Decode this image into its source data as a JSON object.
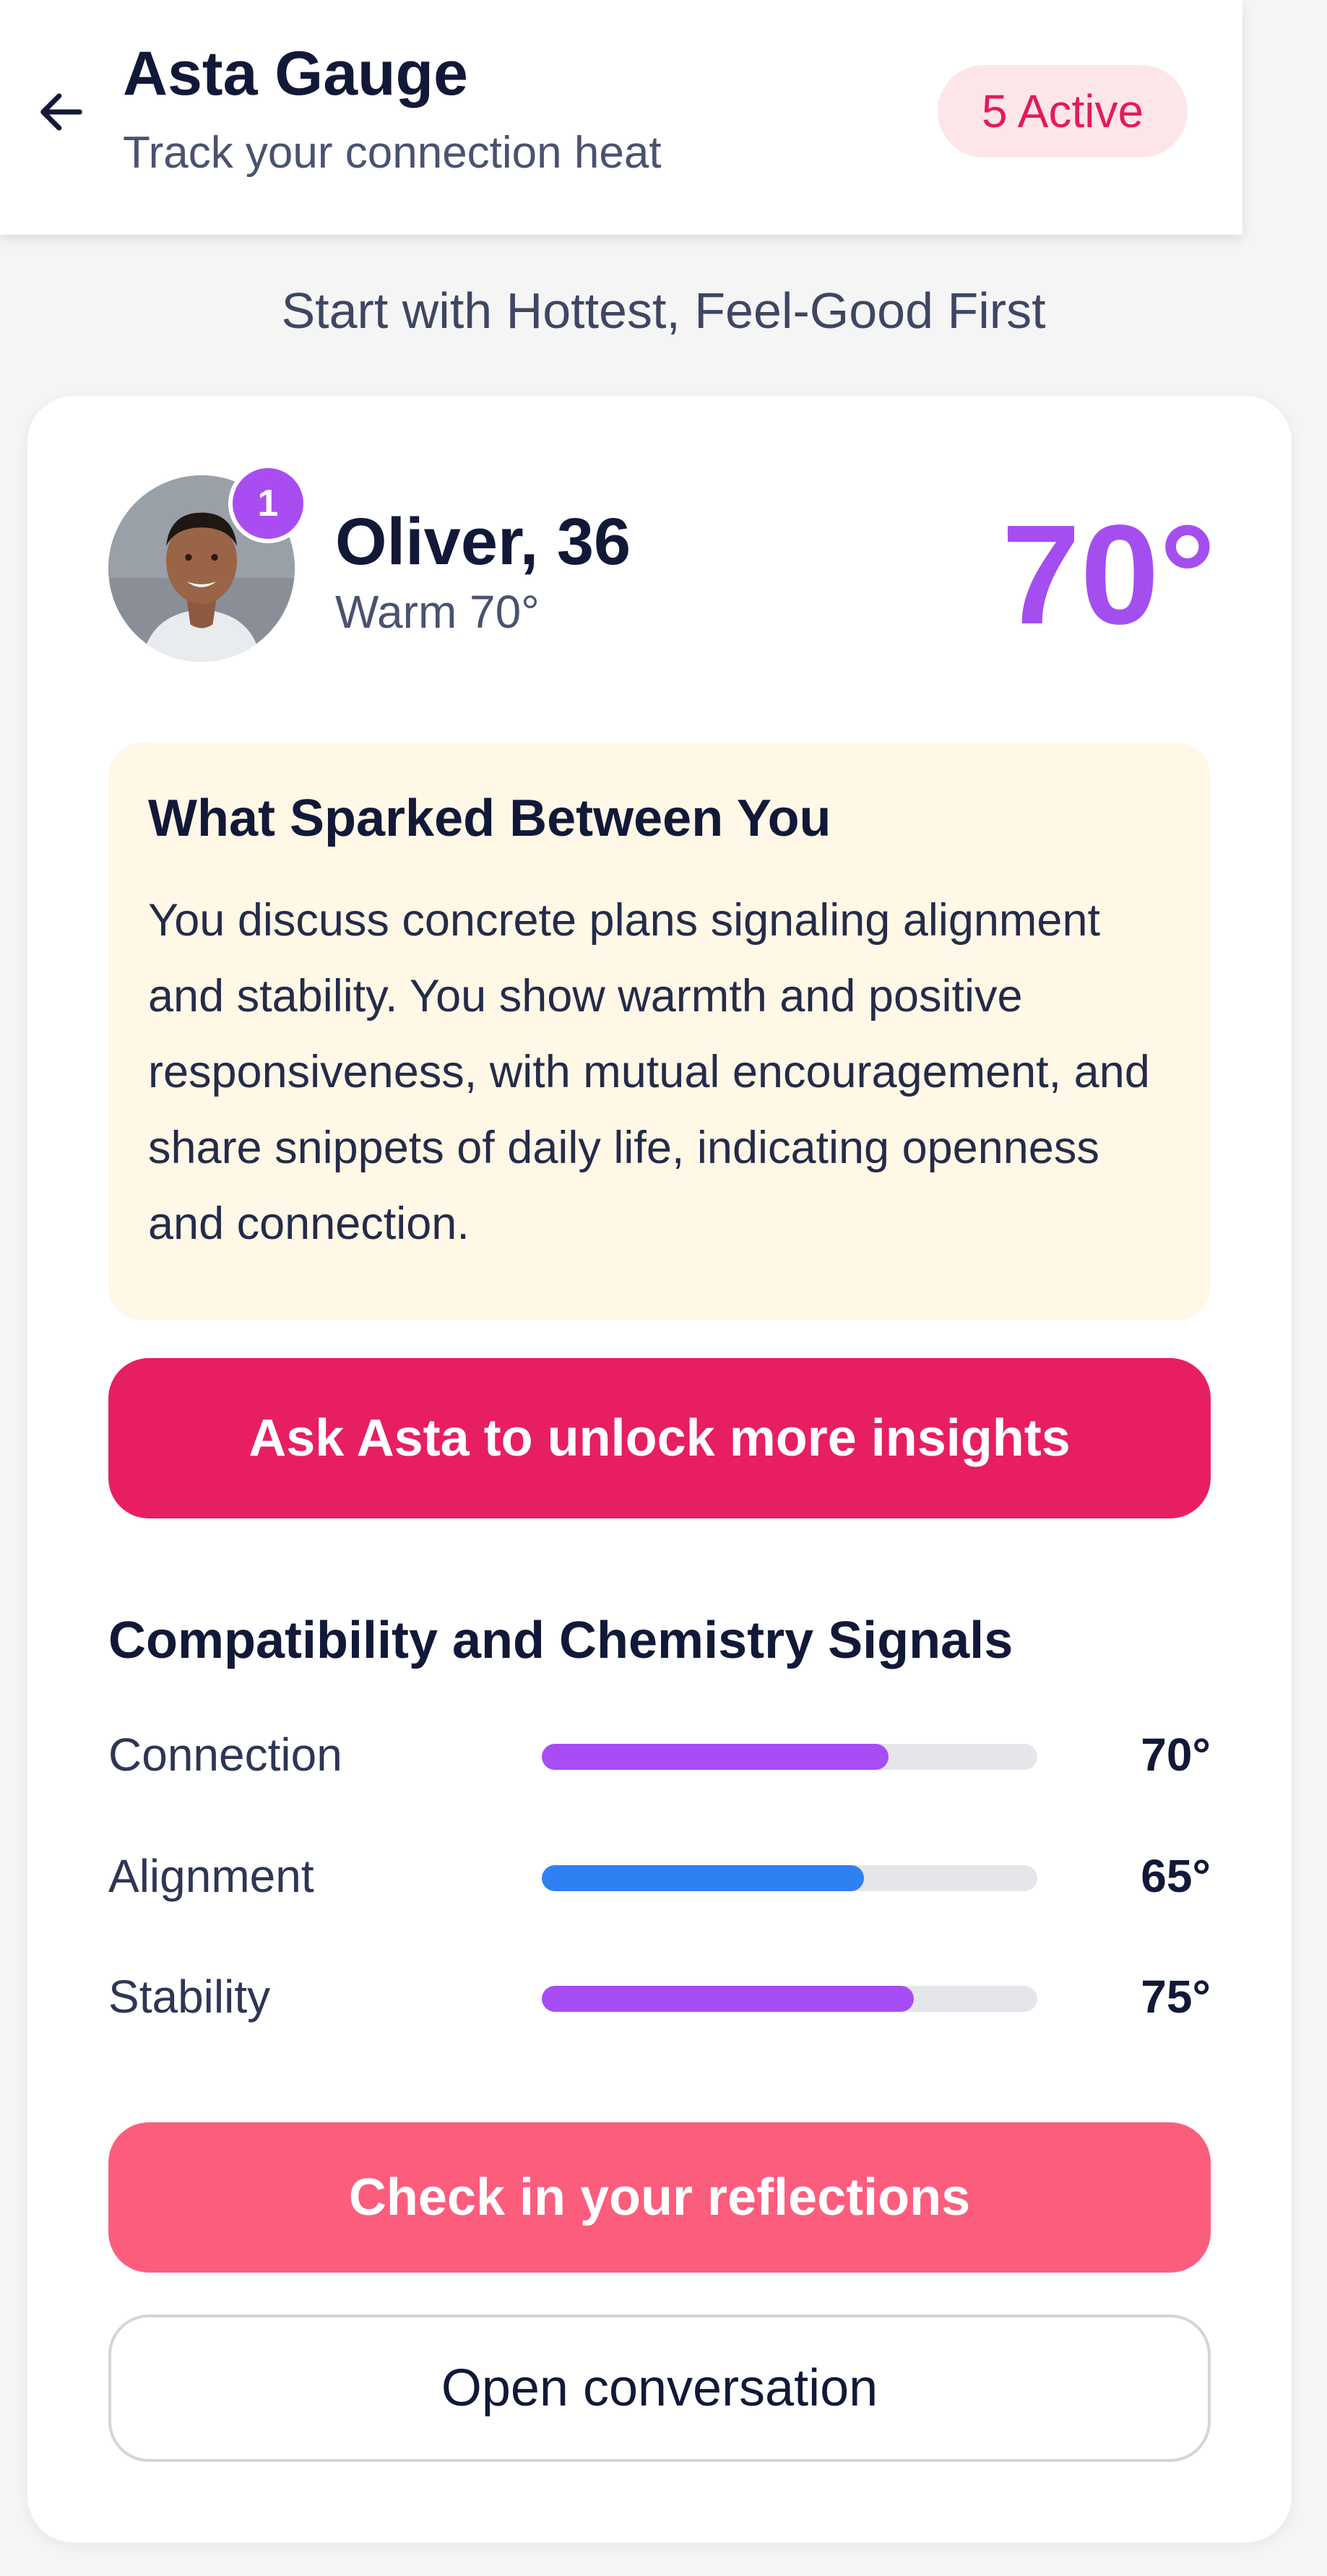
{
  "header": {
    "title": "Asta Gauge",
    "subtitle": "Track your connection heat",
    "active_badge": "5 Active",
    "back_icon": "arrow-left-icon"
  },
  "section_caption": "Start with Hottest, Feel-Good First",
  "match": {
    "rank": "1",
    "name": "Oliver, 36",
    "temp_label": "Warm 70°",
    "temperature": "70°",
    "avatar_icon": "person-avatar-icon"
  },
  "insight": {
    "title": "What Sparked Between You",
    "text": "You discuss concrete plans signaling alignment and stability. You show warmth and positive responsiveness, with mutual encouragement, and share snippets of daily life, indicating openness and connection."
  },
  "unlock_button": "Ask Asta to unlock more insights",
  "signals": {
    "title": "Compatibility and Chemistry Signals",
    "items": [
      {
        "label": "Connection",
        "value": "70°",
        "level": 0.7,
        "color": "#a84cf5"
      },
      {
        "label": "Alignment",
        "value": "65°",
        "level": 0.65,
        "color": "#2f80f2"
      },
      {
        "label": "Stability",
        "value": "75°",
        "level": 0.75,
        "color": "#a84cf5"
      }
    ]
  },
  "reflect_button": "Check in your reflections",
  "open_conversation_button": "Open conversation",
  "colors": {
    "accent_pink": "#e71e63",
    "accent_coral": "#fc5d7d",
    "accent_purple": "#a44ef0",
    "insight_bg": "#fff8e7"
  }
}
